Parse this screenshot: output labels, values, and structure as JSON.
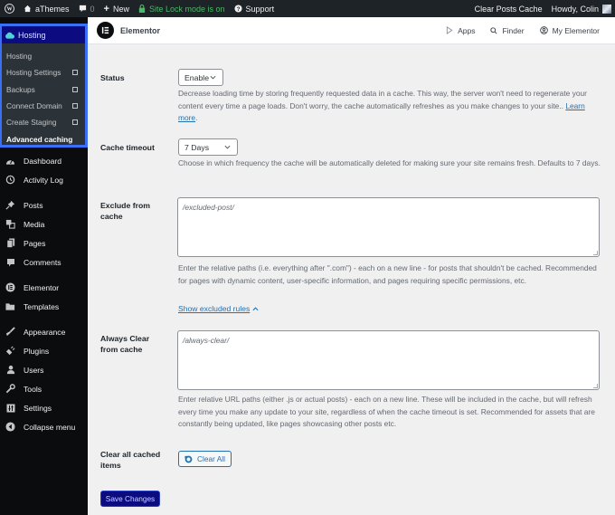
{
  "admin_bar": {
    "site_name": "aThemes",
    "comments_count": "0",
    "new_label": "New",
    "site_lock_label": "Site Lock mode is on",
    "support_label": "Support",
    "clear_cache_label": "Clear Posts Cache",
    "howdy_label": "Howdy, Colin"
  },
  "sidebar": {
    "hosting_header": "Hosting",
    "hosting_submenu": [
      {
        "label": "Hosting",
        "external": false
      },
      {
        "label": "Hosting Settings",
        "external": true
      },
      {
        "label": "Backups",
        "external": true
      },
      {
        "label": "Connect Domain",
        "external": true
      },
      {
        "label": "Create Staging",
        "external": true
      },
      {
        "label": "Advanced caching",
        "external": false,
        "active": true
      }
    ],
    "menu": [
      {
        "label": "Dashboard",
        "icon": "dashboard-icon"
      },
      {
        "label": "Activity Log",
        "icon": "history-icon"
      },
      {
        "label": "Posts",
        "icon": "pin-icon"
      },
      {
        "label": "Media",
        "icon": "media-icon"
      },
      {
        "label": "Pages",
        "icon": "pages-icon"
      },
      {
        "label": "Comments",
        "icon": "comments-icon"
      },
      {
        "label": "Elementor",
        "icon": "elementor-icon"
      },
      {
        "label": "Templates",
        "icon": "folder-icon"
      },
      {
        "label": "Appearance",
        "icon": "brush-icon"
      },
      {
        "label": "Plugins",
        "icon": "plug-icon"
      },
      {
        "label": "Users",
        "icon": "user-icon"
      },
      {
        "label": "Tools",
        "icon": "wrench-icon"
      },
      {
        "label": "Settings",
        "icon": "settings-icon"
      },
      {
        "label": "Collapse menu",
        "icon": "collapse-icon"
      }
    ]
  },
  "topbar": {
    "title": "Elementor",
    "apps_label": "Apps",
    "finder_label": "Finder",
    "my_elementor_label": "My Elementor"
  },
  "settings": {
    "status": {
      "label": "Status",
      "value": "Enable",
      "description": "Decrease loading time by storing frequently requested data in a cache. This way, the server won't need to regenerate your content every time a page loads. Don't worry, the cache automatically refreshes as you make changes to your site..",
      "link": "Learn more"
    },
    "cache_timeout": {
      "label": "Cache timeout",
      "value": "7 Days",
      "description": "Choose in which frequency the cache will be automatically deleted for making sure your site remains fresh. Defaults to 7 days."
    },
    "exclude": {
      "label": "Exclude from cache",
      "placeholder": "/excluded-post/",
      "description": "Enter the relative paths (i.e. everything after \".com\") - each on a new line - for posts that shouldn't be cached. Recommended for pages with dynamic content, user-specific information, and pages requiring specific permissions, etc.",
      "toggle_label": "Show excluded rules"
    },
    "always_clear": {
      "label": "Always Clear from cache",
      "placeholder": "/always-clear/",
      "description": "Enter relative URL paths (either .js or actual posts) - each on a new line. These will be included in the cache, but will refresh every time you make any update to your site, regardless of when the cache timeout is set. Recommended for assets that are constantly being updated, like pages showcasing other posts etc."
    },
    "clear_all": {
      "label": "Clear all cached items",
      "button": "Clear All"
    },
    "save_button": "Save Changes"
  }
}
